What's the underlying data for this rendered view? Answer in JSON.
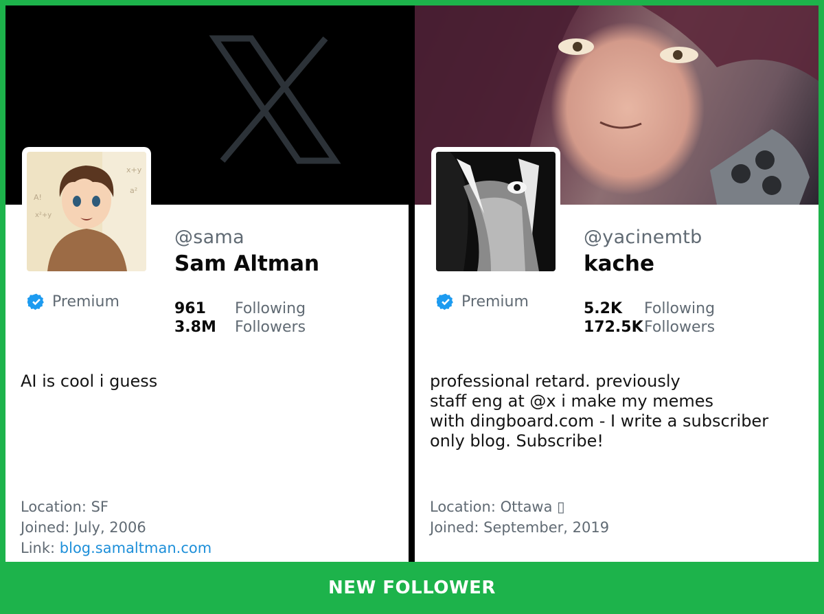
{
  "footer": {
    "label": "NEW FOLLOWER"
  },
  "colors": {
    "frame": "#1db34b",
    "verified": "#1d9bf0",
    "link": "#1d8fd9"
  },
  "profiles": [
    {
      "handle": "@sama",
      "name": "Sam Altman",
      "badge_icon": "verified-badge-icon",
      "premium_label": "Premium",
      "following_count": "961",
      "following_label": "Following",
      "followers_count": "3.8M",
      "followers_label": "Followers",
      "bio": "AI is cool i guess",
      "location": "Location: SF",
      "joined": "Joined: July, 2006",
      "link_label": "Link:",
      "link_url": "blog.samaltman.com"
    },
    {
      "handle": "@yacinemtb",
      "name": "kache",
      "badge_icon": "verified-badge-icon",
      "premium_label": "Premium",
      "following_count": "5.2K",
      "following_label": "Following",
      "followers_count": "172.5K",
      "followers_label": "Followers",
      "bio_lines": [
        "professional retard. previously",
        "staff eng at @x i make my memes",
        "with dingboard.com - I write a subscriber",
        "only blog. Subscribe!"
      ],
      "location": "Location: Ottawa ▯",
      "joined": "Joined: September, 2019"
    }
  ]
}
